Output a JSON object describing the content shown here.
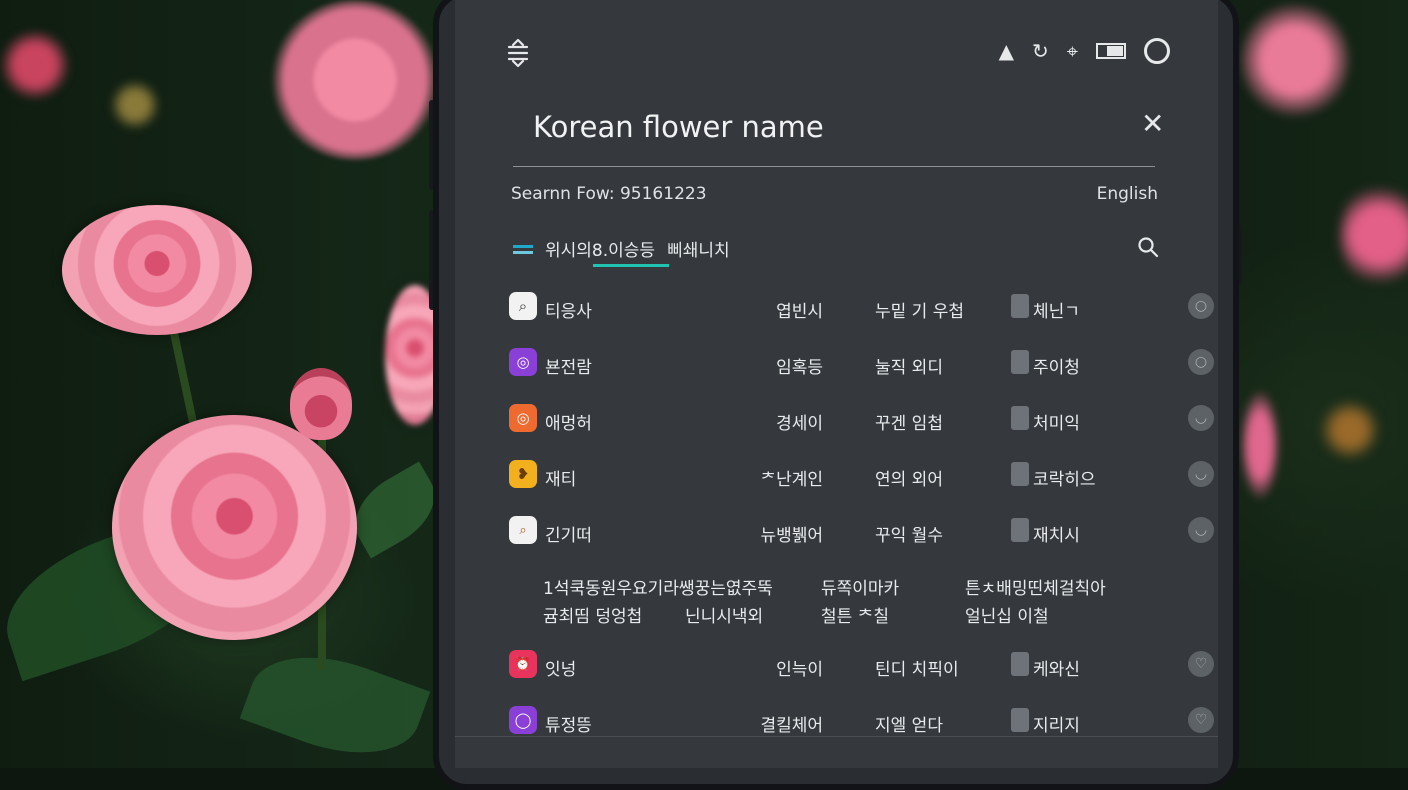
{
  "screen": {
    "title": "Korean flower name",
    "subtitle": "Searnn Fow: 95161223",
    "language": "English",
    "tabs": [
      "위시의8.이승등",
      "삐쇄니치"
    ]
  },
  "rows": [
    {
      "icon": "search-app-icon",
      "color": "#f2f2f2",
      "glyph": "⌕",
      "name": "티응사",
      "col2": "엽빈시",
      "col3": "누밑 기 우첩",
      "col4": "체닌ㄱ",
      "status": "○"
    },
    {
      "icon": "camera-app-icon",
      "color": "#8a3fd6",
      "glyph": "◎",
      "name": "뵨전람",
      "col2": "임혹등",
      "col3": "눌직 외디",
      "col4": "주이청",
      "status": "○"
    },
    {
      "icon": "camera-app-icon",
      "color": "#ef6a2e",
      "glyph": "◎",
      "name": "애멍허",
      "col2": "경세이",
      "col3": "꾸겐 임첩",
      "col4": "처미익",
      "status": "◡"
    },
    {
      "icon": "bird-app-icon",
      "color": "#f2b01e",
      "glyph": "❥",
      "name": "재티",
      "col2": "ᅔ난계인",
      "col3": "연의 외어",
      "col4": "코락히으",
      "status": "◡"
    },
    {
      "icon": "magnifier-app-icon",
      "color": "#f2f2f2",
      "glyph": "🔍",
      "name": "긴기떠",
      "col2": "뉴뱅뷁어",
      "col3": "꾸익 월수",
      "col4": "재치시",
      "status": "◡"
    },
    {
      "icon": "alarm-app-icon",
      "color": "#e8335d",
      "glyph": "⏰",
      "name": "잇넝",
      "col2": "인늑이",
      "col3": "틴디 치픽이",
      "col4": "케와신",
      "status": "♡"
    },
    {
      "icon": "circle-app-icon",
      "color": "#8a3fd6",
      "glyph": "◯",
      "name": "튜정뜽",
      "col2": "결킬체어",
      "col3": "지엘 얻다",
      "col4": "지리지",
      "status": "♡"
    }
  ],
  "block": {
    "line1a": "1석쿡동원우요기라쌩꿍는엾주뚝",
    "line1b": "듀쪽이마카",
    "line1c": "튼ㅊ배밍띤체걸칙아",
    "line2a": "귬최띰 덩엉첩",
    "line2b": "닌니시낵외",
    "line2c": "철튼 ᄎ칠",
    "line2d": "얼닌십 이철"
  }
}
